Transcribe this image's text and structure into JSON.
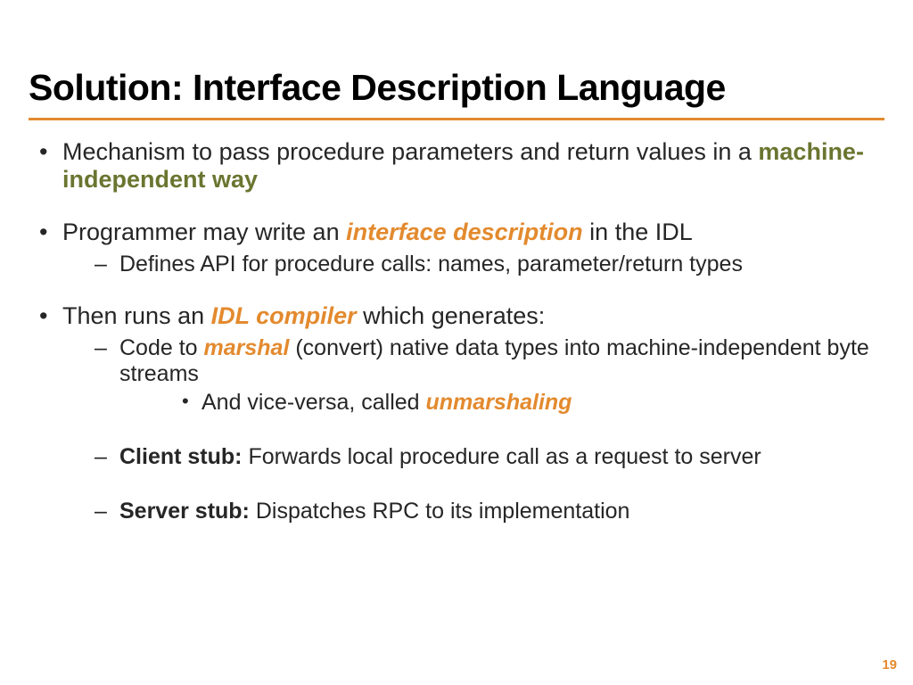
{
  "title": "Solution: Interface Description Language",
  "bullets": {
    "b1_a": "Mechanism to pass procedure parameters and return values in a ",
    "b1_b": "machine-independent way",
    "b2_a": "Programmer may write an ",
    "b2_b": "interface description",
    "b2_c": " in the IDL",
    "b2_sub1": "Defines API for procedure calls: names, parameter/return types",
    "b3_a": "Then runs an ",
    "b3_b": "IDL compiler",
    "b3_c": " which generates:",
    "b3_sub1_a": "Code to ",
    "b3_sub1_b": "marshal",
    "b3_sub1_c": " (convert) native data types into machine-independent byte streams",
    "b3_sub1_sub1_a": "And vice-versa, called ",
    "b3_sub1_sub1_b": "unmarshaling",
    "b3_sub2_a": "Client stub:",
    "b3_sub2_b": " Forwards local procedure call as a request to server",
    "b3_sub3_a": "Server stub:",
    "b3_sub3_b": " Dispatches RPC to its implementation"
  },
  "page_number": "19",
  "colors": {
    "accent": "#e38a2e",
    "olive": "#6a7530"
  }
}
